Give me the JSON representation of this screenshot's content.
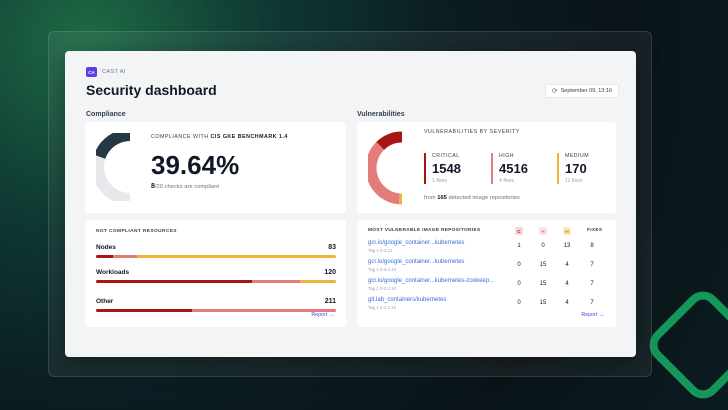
{
  "colors": {
    "accent": "#4f46e5",
    "critical": "#a81515",
    "high": "#e47c7c",
    "medium": "#efb53a",
    "donut_dark": "#253844",
    "donut_light": "#e6e8ec"
  },
  "brand": {
    "logo": "CA",
    "name": "CAST AI"
  },
  "header": {
    "title": "Security dashboard",
    "date": "September 09, 13:16",
    "refresh_icon": "refresh-icon"
  },
  "compliance": {
    "section_title": "Compliance",
    "heading_prefix": "COMPLIANCE WITH",
    "heading_bold": "CIS GKE BENCHMARK 1.4",
    "percent": "39.64%",
    "percent_value": 39.64,
    "passed": "8",
    "total": "/20",
    "sub_label": "checks are compliant"
  },
  "vulnerabilities": {
    "section_title": "Vulnerabilities",
    "heading": "VULNERABILITIES BY SEVERITY",
    "critical": {
      "label": "CRITICAL",
      "count": "1548",
      "fixes": "1 fixes"
    },
    "high": {
      "label": "HIGH",
      "count": "4516",
      "fixes": "4 fixes"
    },
    "medium": {
      "label": "MEDIUM",
      "count": "170",
      "fixes": "11 fixes"
    },
    "footer_prefix": "from",
    "footer_count": "165",
    "footer_suffix": "detected image repositories"
  },
  "resources": {
    "heading": "NOT COMPLIANT RESOURCES",
    "rows": [
      {
        "name": "Nodes",
        "count": "83",
        "segments": [
          0.07,
          0.1,
          0.83
        ]
      },
      {
        "name": "Workloads",
        "count": "120",
        "segments": [
          0.65,
          0.2,
          0.15
        ]
      },
      {
        "name": "Other",
        "count": "211",
        "segments": [
          0.4,
          0.6,
          0.0
        ]
      }
    ],
    "report_label": "Report →"
  },
  "repositories": {
    "heading": "MOST VULNERABLE IMAGE REPOSITORIES",
    "col_c": "C",
    "col_h": "H",
    "col_m": "M",
    "col_fixes": "FIXES",
    "rows": [
      {
        "name": "gcr.io/google_container...kubernetes",
        "tag": "Tag 1.0-4.21",
        "c": "1",
        "h": "0",
        "m": "13",
        "fixes": "8"
      },
      {
        "name": "gcr.io/google_container...kubernetes",
        "tag": "Tag 1.0-3.4.10",
        "c": "0",
        "h": "15",
        "m": "4",
        "fixes": "7"
      },
      {
        "name": "gcr.io/google_container...kubernetes-zookeep...",
        "tag": "Tag 1.0-3.4.10",
        "c": "0",
        "h": "15",
        "m": "4",
        "fixes": "7"
      },
      {
        "name": "git.lab_containers/kubernetes",
        "tag": "Tag 1.0-3.4.10",
        "c": "0",
        "h": "15",
        "m": "4",
        "fixes": "7"
      }
    ],
    "report_label": "Report →"
  }
}
